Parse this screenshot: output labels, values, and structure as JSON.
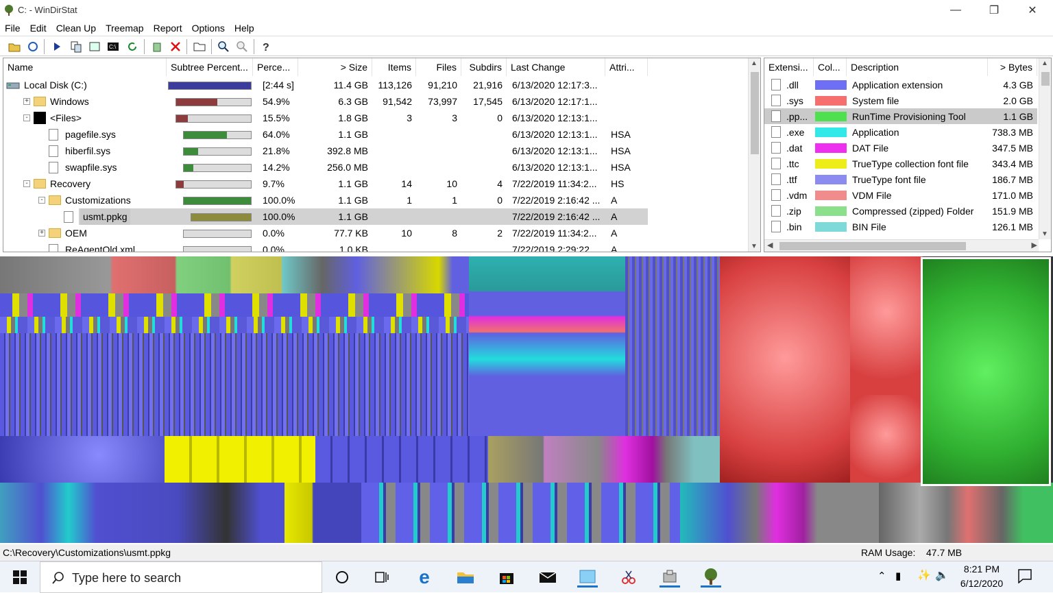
{
  "window": {
    "title": "C: - WinDirStat"
  },
  "menu": [
    "File",
    "Edit",
    "Clean Up",
    "Treemap",
    "Report",
    "Options",
    "Help"
  ],
  "tree": {
    "headers": [
      "Name",
      "Subtree Percent...",
      "Perce...",
      "> Size",
      "Items",
      "Files",
      "Subdirs",
      "Last Change",
      "Attri..."
    ],
    "rows": [
      {
        "name": "Local Disk (C:)",
        "pct": "[2:44 s]",
        "size": "11.4 GB",
        "items": "113,126",
        "files": "91,210",
        "subdirs": "21,916",
        "changed": "6/13/2020 12:17:3...",
        "attr": "",
        "bar": 1.0,
        "color": "#3c3c9c"
      },
      {
        "name": "Windows",
        "pct": "54.9%",
        "size": "6.3 GB",
        "items": "91,542",
        "files": "73,997",
        "subdirs": "17,545",
        "changed": "6/13/2020 12:17:1...",
        "attr": "",
        "bar": 0.549,
        "color": "#8c3c3c"
      },
      {
        "name": "<Files>",
        "pct": "15.5%",
        "size": "1.8 GB",
        "items": "3",
        "files": "3",
        "subdirs": "0",
        "changed": "6/13/2020 12:13:1...",
        "attr": "",
        "bar": 0.155,
        "color": "#8c3c3c"
      },
      {
        "name": "pagefile.sys",
        "pct": "64.0%",
        "size": "1.1 GB",
        "items": "",
        "files": "",
        "subdirs": "",
        "changed": "6/13/2020 12:13:1...",
        "attr": "HSA",
        "bar": 0.64,
        "color": "#3c8c3c"
      },
      {
        "name": "hiberfil.sys",
        "pct": "21.8%",
        "size": "392.8 MB",
        "items": "",
        "files": "",
        "subdirs": "",
        "changed": "6/13/2020 12:13:1...",
        "attr": "HSA",
        "bar": 0.218,
        "color": "#3c8c3c"
      },
      {
        "name": "swapfile.sys",
        "pct": "14.2%",
        "size": "256.0 MB",
        "items": "",
        "files": "",
        "subdirs": "",
        "changed": "6/13/2020 12:13:1...",
        "attr": "HSA",
        "bar": 0.142,
        "color": "#3c8c3c"
      },
      {
        "name": "Recovery",
        "pct": "9.7%",
        "size": "1.1 GB",
        "items": "14",
        "files": "10",
        "subdirs": "4",
        "changed": "7/22/2019 11:34:2...",
        "attr": "HS",
        "bar": 0.097,
        "color": "#8c3c3c"
      },
      {
        "name": "Customizations",
        "pct": "100.0%",
        "size": "1.1 GB",
        "items": "1",
        "files": "1",
        "subdirs": "0",
        "changed": "7/22/2019 2:16:42 ...",
        "attr": "A",
        "bar": 1.0,
        "color": "#3c8c3c"
      },
      {
        "name": "usmt.ppkg",
        "pct": "100.0%",
        "size": "1.1 GB",
        "items": "",
        "files": "",
        "subdirs": "",
        "changed": "7/22/2019 2:16:42 ...",
        "attr": "A",
        "bar": 1.0,
        "color": "#8c8c3c"
      },
      {
        "name": "OEM",
        "pct": "0.0%",
        "size": "77.7 KB",
        "items": "10",
        "files": "8",
        "subdirs": "2",
        "changed": "7/22/2019 11:34:2...",
        "attr": "A",
        "bar": 0.0,
        "color": "#3c8c3c"
      },
      {
        "name": "ReAgentOld.xml",
        "pct": "0.0%",
        "size": "1.0 KB",
        "items": "",
        "files": "",
        "subdirs": "",
        "changed": "7/22/2019 2:29:22 ...",
        "attr": "A",
        "bar": 0.0,
        "color": "#3c8c3c"
      }
    ]
  },
  "extensions": {
    "headers": [
      "Extensi...",
      "Col...",
      "Description",
      "> Bytes"
    ],
    "rows": [
      {
        "ext": ".dll",
        "color": "#6f6ff5",
        "desc": "Application extension",
        "bytes": "4.3 GB"
      },
      {
        "ext": ".sys",
        "color": "#f56f6f",
        "desc": "System file",
        "bytes": "2.0 GB"
      },
      {
        "ext": ".pp...",
        "color": "#4fe04f",
        "desc": "RunTime Provisioning Tool",
        "bytes": "1.1 GB"
      },
      {
        "ext": ".exe",
        "color": "#33e8e8",
        "desc": "Application",
        "bytes": "738.3 MB"
      },
      {
        "ext": ".dat",
        "color": "#ef2fef",
        "desc": "DAT File",
        "bytes": "347.5 MB"
      },
      {
        "ext": ".ttc",
        "color": "#eded1a",
        "desc": "TrueType collection font file",
        "bytes": "343.4 MB"
      },
      {
        "ext": ".ttf",
        "color": "#8c8cf0",
        "desc": "TrueType font file",
        "bytes": "186.7 MB"
      },
      {
        "ext": ".vdm",
        "color": "#f08c8c",
        "desc": "VDM File",
        "bytes": "171.0 MB"
      },
      {
        "ext": ".zip",
        "color": "#8ce08c",
        "desc": "Compressed (zipped) Folder",
        "bytes": "151.9 MB"
      },
      {
        "ext": ".bin",
        "color": "#7ed9d9",
        "desc": "BIN File",
        "bytes": "126.1 MB"
      }
    ]
  },
  "status": {
    "path": "C:\\Recovery\\Customizations\\usmt.ppkg",
    "ram_label": "RAM Usage:",
    "ram_value": "47.7 MB"
  },
  "taskbar": {
    "search_placeholder": "Type here to search",
    "time": "8:21 PM",
    "date": "6/12/2020"
  }
}
